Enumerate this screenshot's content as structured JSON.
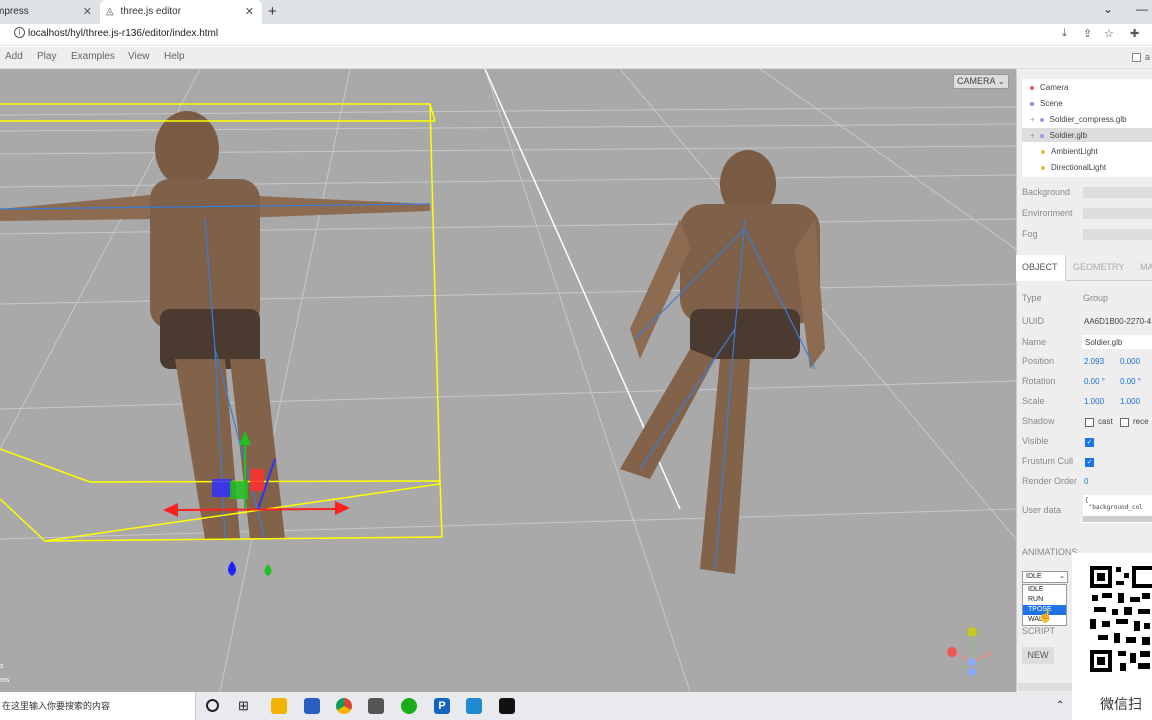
{
  "browser": {
    "tabs": [
      {
        "title": "mpress"
      },
      {
        "title": "three.js editor"
      }
    ],
    "url": "localhost/hyl/three.js-r136/editor/index.html"
  },
  "menubar": {
    "items": [
      "Add",
      "Play",
      "Examples",
      "View",
      "Help"
    ]
  },
  "viewport": {
    "camera_select": "CAMERA",
    "status_lines": [
      "s",
      "ms"
    ]
  },
  "outliner": {
    "items": [
      {
        "label": "Camera",
        "color": "#e06060"
      },
      {
        "label": "Scene",
        "color": "#8a8ad8"
      },
      {
        "label": "Soldier_compress.glb",
        "color": "#b090e0"
      },
      {
        "label": "Soldier.glb",
        "color": "#b090e0"
      },
      {
        "label": "AmbientLight",
        "color": "#e0c040"
      },
      {
        "label": "DirectionalLight",
        "color": "#e0c040"
      }
    ]
  },
  "scene_props": {
    "background_label": "Background",
    "environment_label": "Environment",
    "fog_label": "Fog"
  },
  "properties_tabs": [
    "OBJECT",
    "GEOMETRY",
    "MA"
  ],
  "object": {
    "type_label": "Type",
    "type_value": "Group",
    "uuid_label": "UUID",
    "uuid_value": "AA6D1B00-2270-4",
    "name_label": "Name",
    "name_value": "Soldier.glb",
    "position_label": "Position",
    "position_x": "2.093",
    "position_y": "0.000",
    "rotation_label": "Rotation",
    "rotation_x": "0.00 °",
    "rotation_y": "0.00 °",
    "scale_label": "Scale",
    "scale_x": "1.000",
    "scale_y": "1.000",
    "shadow_label": "Shadow",
    "shadow_cast": "cast",
    "shadow_receive": "rece",
    "visible_label": "Visible",
    "frustum_label": "Frustum Cull",
    "render_order_label": "Render Order",
    "render_order_value": "0",
    "userdata_label": "User data",
    "userdata_value": "{\n \"background_col"
  },
  "animations": {
    "heading": "ANIMATIONS",
    "selected": "IDLE",
    "options": [
      "IDLE",
      "RUN",
      "TPOSE",
      "WALK"
    ],
    "highlighted": "TPOSE"
  },
  "script": {
    "heading": "SCRIPT",
    "new_label": "NEW"
  },
  "overlay": {
    "wechat_text": "微信扫"
  },
  "taskbar": {
    "search_placeholder": "在这里输入你要搜索的内容"
  }
}
